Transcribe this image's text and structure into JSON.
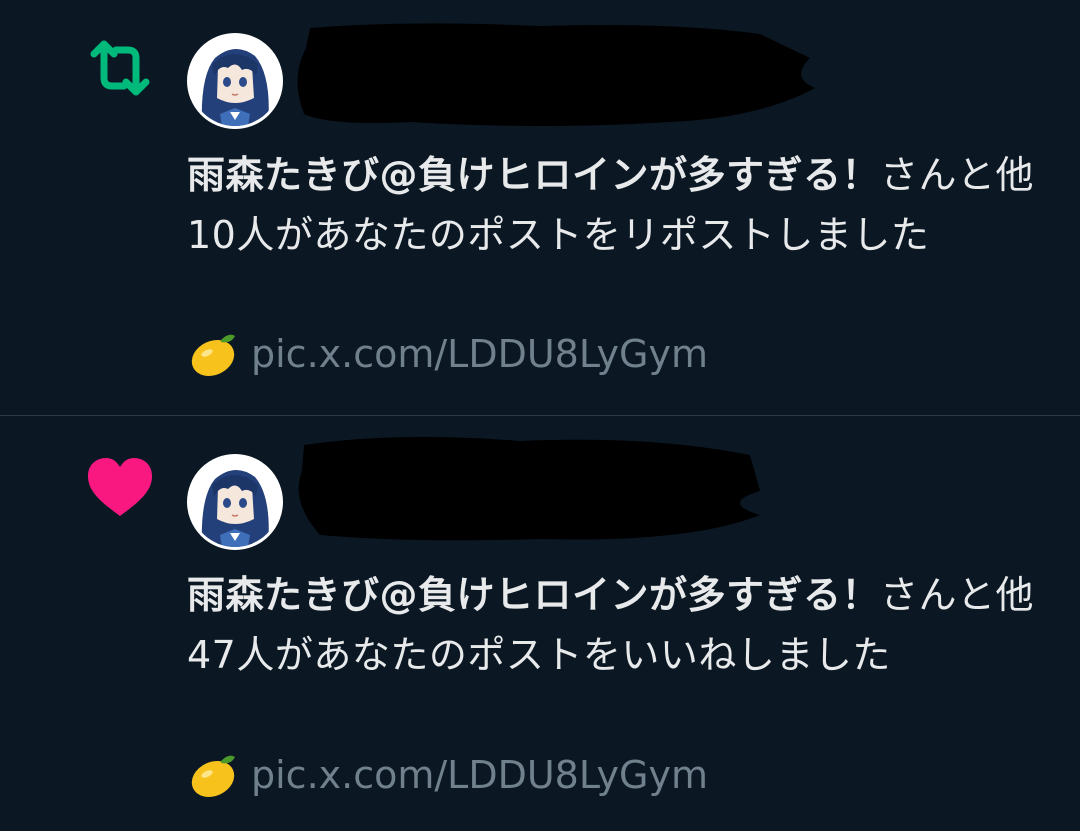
{
  "notifications": [
    {
      "type": "repost",
      "icon": "repost-icon",
      "icon_color": "#00ba7c",
      "actor": "雨森たきび@負けヒロインが多すぎる！",
      "text": "さんと他10人があなたのポストをリポストしました",
      "preview": {
        "emoji_icon": "lemon-icon",
        "link": "pic.x.com/LDDU8LyGym"
      }
    },
    {
      "type": "like",
      "icon": "heart-icon",
      "icon_color": "#f91880",
      "actor": "雨森たきび@負けヒロインが多すぎる！",
      "text": "さんと他47人があなたのポストをいいねしました",
      "preview": {
        "emoji_icon": "lemon-icon",
        "link": "pic.x.com/LDDU8LyGym"
      }
    }
  ],
  "theme": {
    "background": "#0b1824",
    "text": "#e7e9ea",
    "muted": "#71808d",
    "divider": "#2c3a47"
  }
}
